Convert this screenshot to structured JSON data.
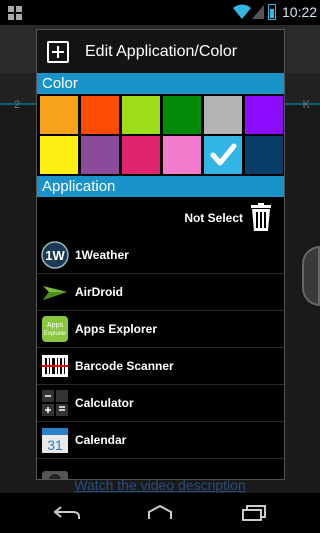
{
  "status_bar": {
    "time": "10:22"
  },
  "background": {
    "tab_left": "2",
    "tab_right": "K",
    "footer_link": "Watch the video description"
  },
  "dialog": {
    "title": "Edit Application/Color",
    "color_section_label": "Color",
    "application_section_label": "Application",
    "not_select_label": "Not Select",
    "colors": [
      "#f7a21b",
      "#ff4c00",
      "#9ddd17",
      "#008a08",
      "#b3b3b3",
      "#8c0dff",
      "#ffef12",
      "#8a4b9a",
      "#e0236e",
      "#f27cce",
      "#33b5e5",
      "#083d6a"
    ],
    "selected_color": "#33b5e5",
    "apps": [
      {
        "label": "1Weather",
        "icon": "1weather-icon"
      },
      {
        "label": "AirDroid",
        "icon": "airdroid-icon"
      },
      {
        "label": "Apps Explorer",
        "icon": "apps-explorer-icon"
      },
      {
        "label": "Barcode Scanner",
        "icon": "barcode-icon"
      },
      {
        "label": "Calculator",
        "icon": "calculator-icon"
      },
      {
        "label": "Calendar",
        "icon": "calendar-icon"
      },
      {
        "label": "",
        "icon": "camera-icon"
      }
    ]
  }
}
